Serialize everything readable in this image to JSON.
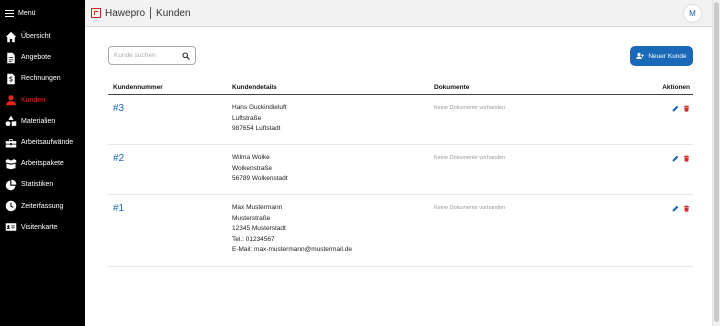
{
  "sidebar": {
    "menu_label": "Menü",
    "items": [
      {
        "label": "Übersicht",
        "icon": "home-icon"
      },
      {
        "label": "Angebote",
        "icon": "document-icon"
      },
      {
        "label": "Rechnungen",
        "icon": "invoice-icon"
      },
      {
        "label": "Kunden",
        "icon": "person-icon",
        "active": true
      },
      {
        "label": "Materialien",
        "icon": "shapes-icon"
      },
      {
        "label": "Arbeitsaufwände",
        "icon": "toolbox-icon"
      },
      {
        "label": "Arbeitspakete",
        "icon": "box-icon"
      },
      {
        "label": "Statistiken",
        "icon": "pie-chart-icon"
      },
      {
        "label": "Zeiterfassung",
        "icon": "clock-icon"
      },
      {
        "label": "Visitenkarte",
        "icon": "id-card-icon"
      }
    ],
    "active_color": "#e5261f"
  },
  "header": {
    "brand": "Hawepro",
    "page_title": "Kunden",
    "avatar_initial": "M"
  },
  "search": {
    "placeholder": "Kunde suchen",
    "value": ""
  },
  "new_customer_button": {
    "label": "Neuer Kunde",
    "color": "#1a68b8"
  },
  "table": {
    "columns": [
      "Kundennummer",
      "Kundendetails",
      "Dokumente",
      "Aktionen"
    ],
    "rows": [
      {
        "number": "#3",
        "details": [
          "Hans Guckindieluft",
          "Luftstraße",
          "987654 Luftstadt"
        ],
        "documents": "Keine Dokumente vorhanden"
      },
      {
        "number": "#2",
        "details": [
          "Wilma Wolke",
          "Wolkenstraße",
          "56789 Wolkenstadt"
        ],
        "documents": "Keine Dokumente vorhanden"
      },
      {
        "number": "#1",
        "details": [
          "Max Mustermann",
          "Musterstraße",
          "12345 Musterstadt",
          "Tel.: 01234567",
          "E-Mail: max-mustermann@mustermail.de"
        ],
        "documents": "Keine Dokumente vorhanden"
      }
    ]
  }
}
